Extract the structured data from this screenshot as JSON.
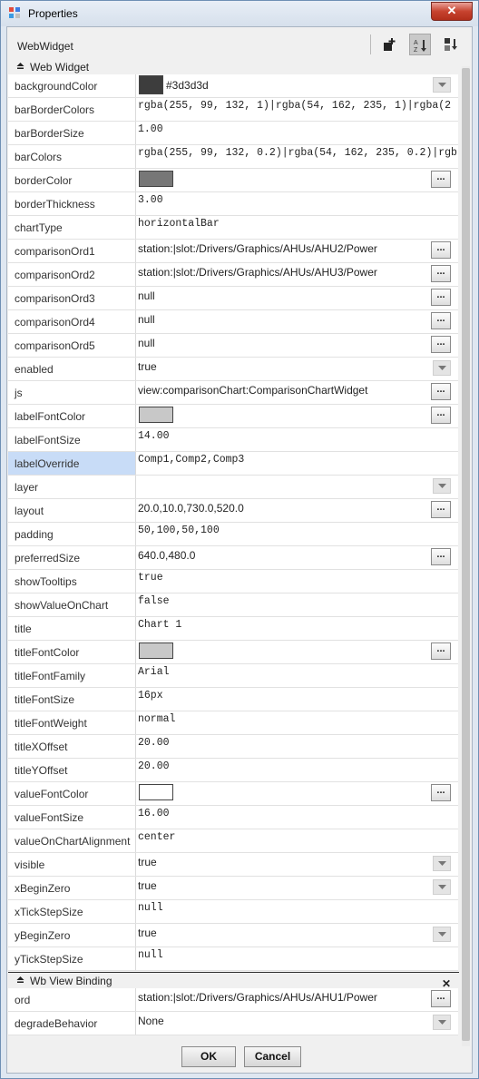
{
  "window": {
    "title": "Properties",
    "close_glyph": "✕"
  },
  "toolbar": {
    "title": "WebWidget",
    "icons": [
      "add-slot-icon",
      "sort-az-icon",
      "sort-order-icon"
    ]
  },
  "sections": [
    {
      "title": "Web Widget",
      "rows": [
        {
          "name": "backgroundColor",
          "value": "#3d3d3d",
          "kind": "color-dropdown",
          "swatch": "#3d3d3d"
        },
        {
          "name": "barBorderColors",
          "value": "rgba(255, 99, 132, 1)|rgba(54, 162, 235, 1)|rgba(2",
          "kind": "mono"
        },
        {
          "name": "barBorderSize",
          "value": "1.00",
          "kind": "mono"
        },
        {
          "name": "barColors",
          "value": "rgba(255, 99, 132, 0.2)|rgba(54, 162, 235, 0.2)|rgb",
          "kind": "mono"
        },
        {
          "name": "borderColor",
          "value": "",
          "kind": "color-ellipsis",
          "swatch": "#777777"
        },
        {
          "name": "borderThickness",
          "value": "3.00",
          "kind": "mono"
        },
        {
          "name": "chartType",
          "value": "horizontalBar",
          "kind": "mono"
        },
        {
          "name": "comparisonOrd1",
          "value": "station:|slot:/Drivers/Graphics/AHUs/AHU2/Power",
          "kind": "ellipsis"
        },
        {
          "name": "comparisonOrd2",
          "value": "station:|slot:/Drivers/Graphics/AHUs/AHU3/Power",
          "kind": "ellipsis"
        },
        {
          "name": "comparisonOrd3",
          "value": "null",
          "kind": "ellipsis"
        },
        {
          "name": "comparisonOrd4",
          "value": "null",
          "kind": "ellipsis"
        },
        {
          "name": "comparisonOrd5",
          "value": "null",
          "kind": "ellipsis"
        },
        {
          "name": "enabled",
          "value": "true",
          "kind": "dropdown"
        },
        {
          "name": "js",
          "value": "view:comparisonChart:ComparisonChartWidget",
          "kind": "ellipsis"
        },
        {
          "name": "labelFontColor",
          "value": "",
          "kind": "color-ellipsis",
          "swatch": "#c8c8c8"
        },
        {
          "name": "labelFontSize",
          "value": "14.00",
          "kind": "mono"
        },
        {
          "name": "labelOverride",
          "value": "Comp1,Comp2,Comp3",
          "kind": "mono",
          "selected": true
        },
        {
          "name": "layer",
          "value": "",
          "kind": "dropdown"
        },
        {
          "name": "layout",
          "value": "20.0,10.0,730.0,520.0",
          "kind": "ellipsis"
        },
        {
          "name": "padding",
          "value": "50,100,50,100",
          "kind": "mono"
        },
        {
          "name": "preferredSize",
          "value": "640.0,480.0",
          "kind": "ellipsis"
        },
        {
          "name": "showTooltips",
          "value": "true",
          "kind": "mono"
        },
        {
          "name": "showValueOnChart",
          "value": "false",
          "kind": "mono"
        },
        {
          "name": "title",
          "value": "Chart 1",
          "kind": "mono"
        },
        {
          "name": "titleFontColor",
          "value": "",
          "kind": "color-ellipsis",
          "swatch": "#c8c8c8"
        },
        {
          "name": "titleFontFamily",
          "value": "Arial",
          "kind": "mono"
        },
        {
          "name": "titleFontSize",
          "value": "16px",
          "kind": "mono"
        },
        {
          "name": "titleFontWeight",
          "value": "normal",
          "kind": "mono"
        },
        {
          "name": "titleXOffset",
          "value": "20.00",
          "kind": "mono"
        },
        {
          "name": "titleYOffset",
          "value": "20.00",
          "kind": "mono"
        },
        {
          "name": "valueFontColor",
          "value": "",
          "kind": "color-ellipsis",
          "swatch": "#ffffff"
        },
        {
          "name": "valueFontSize",
          "value": "16.00",
          "kind": "mono"
        },
        {
          "name": "valueOnChartAlignment",
          "value": "center",
          "kind": "mono"
        },
        {
          "name": "visible",
          "value": "true",
          "kind": "dropdown"
        },
        {
          "name": "xBeginZero",
          "value": "true",
          "kind": "dropdown"
        },
        {
          "name": "xTickStepSize",
          "value": "null",
          "kind": "mono"
        },
        {
          "name": "yBeginZero",
          "value": "true",
          "kind": "dropdown"
        },
        {
          "name": "yTickStepSize",
          "value": "null",
          "kind": "mono"
        }
      ]
    },
    {
      "title": "Wb View Binding",
      "closable": true,
      "rows": [
        {
          "name": "ord",
          "value": "station:|slot:/Drivers/Graphics/AHUs/AHU1/Power",
          "kind": "ellipsis"
        },
        {
          "name": "degradeBehavior",
          "value": "None",
          "kind": "dropdown"
        }
      ]
    }
  ],
  "buttons": {
    "ok": "OK",
    "cancel": "Cancel"
  },
  "glyphs": {
    "ellipsis": "...",
    "section_close": "✕"
  }
}
